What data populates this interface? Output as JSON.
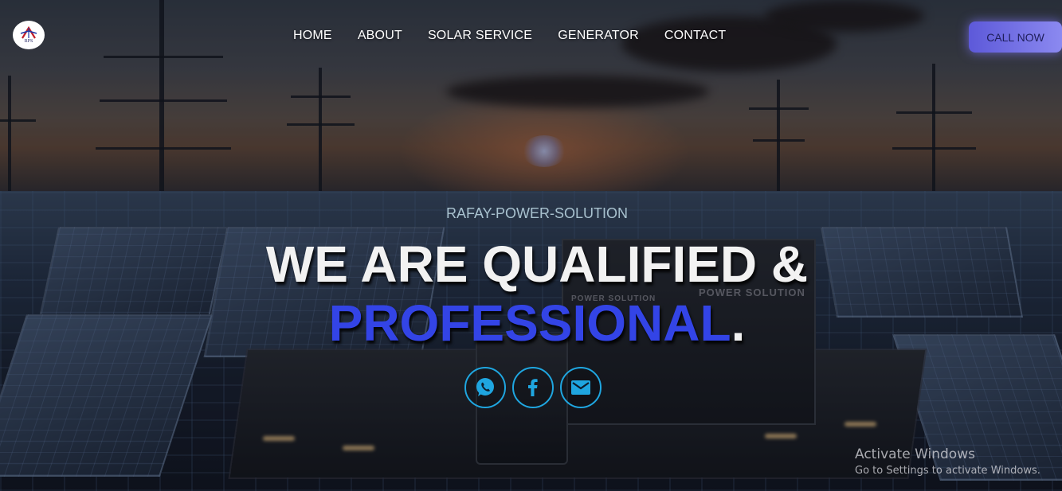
{
  "header": {
    "logo_text": "RPS",
    "nav": [
      "HOME",
      "ABOUT",
      "SOLAR SERVICE",
      "GENERATOR",
      "CONTACT"
    ],
    "cta_label": "CALL NOW"
  },
  "hero": {
    "subtitle": "RAFAY-POWER-SOLUTION",
    "headline_line1": "WE ARE QUALIFIED &",
    "headline_line2": "PROFESSIONAL",
    "headline_dot": ".",
    "generator_text_1": "POWER SOLUTION",
    "generator_text_2": "POWER SOLUTION",
    "accent_color": "#3344e6",
    "social_icons": [
      "whatsapp-icon",
      "facebook-icon",
      "mail-icon"
    ],
    "social_ring_color": "#1fa6e0"
  },
  "watermark": {
    "title": "Activate Windows",
    "subtitle": "Go to Settings to activate Windows."
  }
}
